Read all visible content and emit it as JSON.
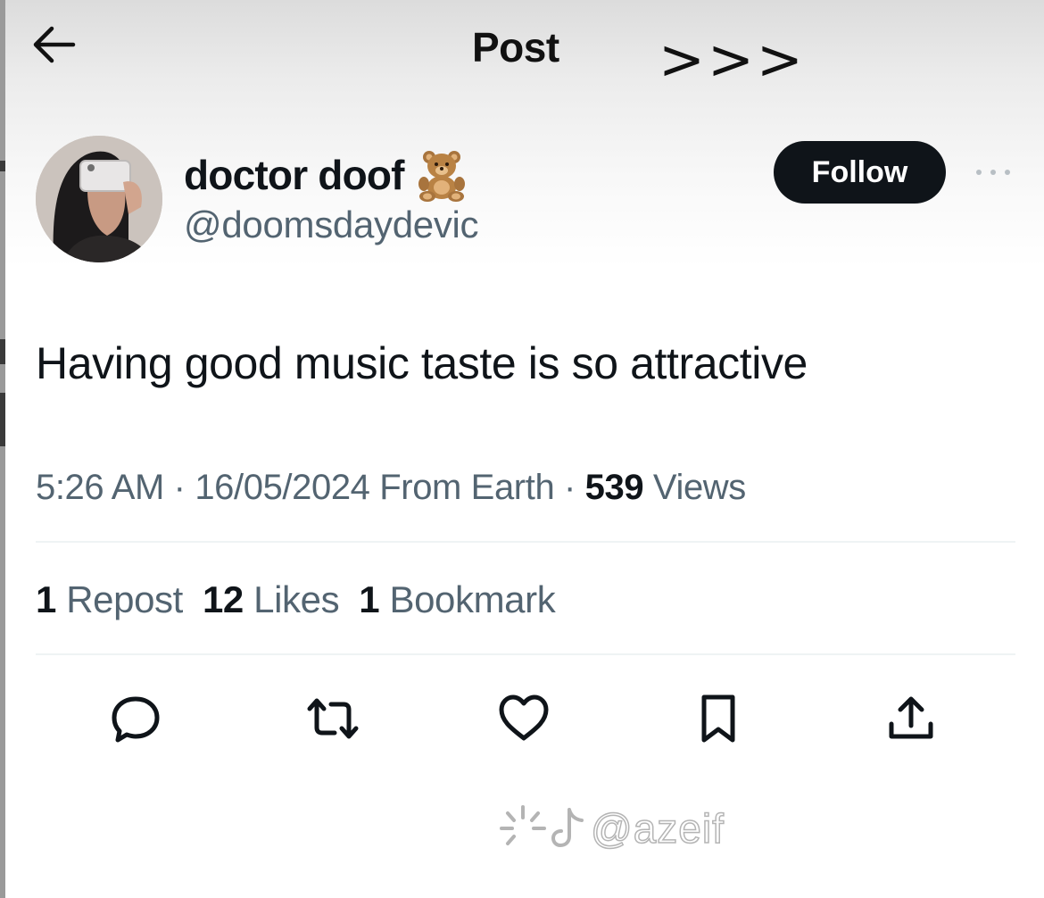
{
  "header": {
    "title": "Post",
    "overlay_text": ">>>"
  },
  "author": {
    "display_name": "doctor doof",
    "emoji": "teddy-bear-emoji",
    "handle": "@doomsdaydevic",
    "follow_label": "Follow"
  },
  "post": {
    "text": "Having good music taste is so attractive",
    "time": "5:26 AM",
    "date": "16/05/2024",
    "location": "From Earth",
    "views_count": "539",
    "views_label": "Views"
  },
  "stats": {
    "reposts_count": "1",
    "reposts_label": "Repost",
    "likes_count": "12",
    "likes_label": "Likes",
    "bookmarks_count": "1",
    "bookmarks_label": "Bookmark"
  },
  "actions": [
    "reply-icon",
    "repost-icon",
    "like-icon",
    "bookmark-icon",
    "share-icon"
  ],
  "watermark": {
    "text": "@azeif",
    "icon": "tiktok-icon"
  },
  "colors": {
    "text_primary": "#0f1419",
    "text_secondary": "#536471",
    "follow_button_bg": "#0f1419",
    "divider": "#eff3f4"
  }
}
